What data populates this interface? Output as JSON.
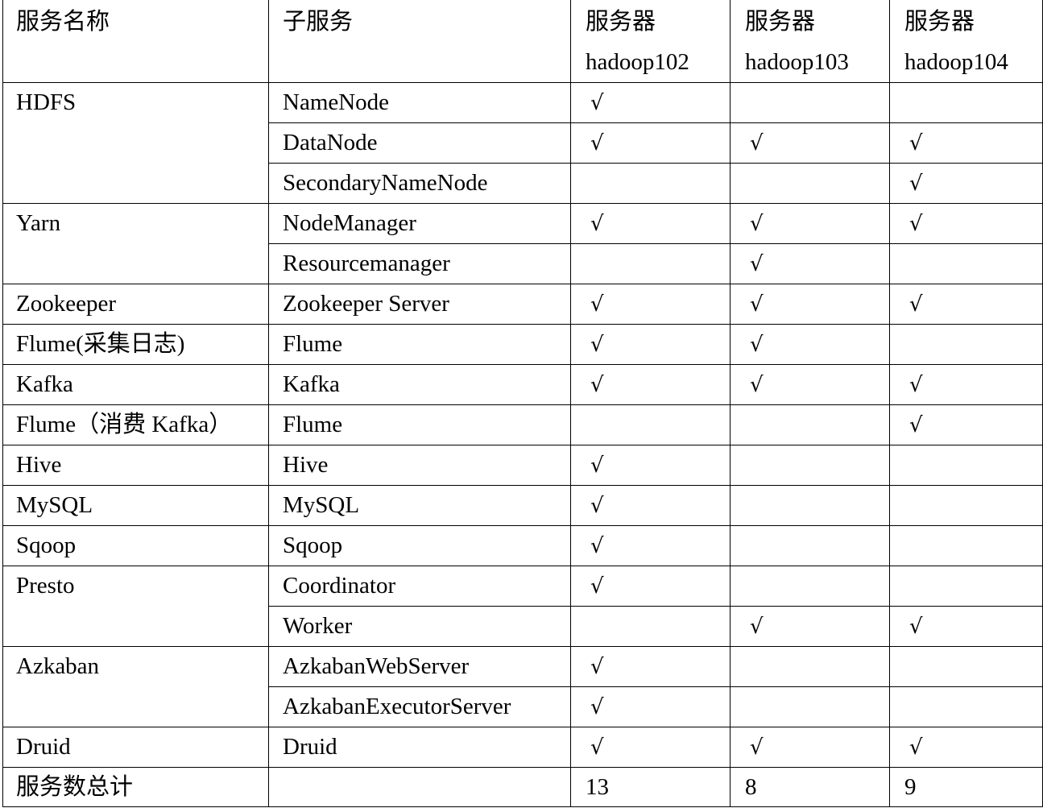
{
  "table": {
    "headers": {
      "service_name": "服务名称",
      "sub_service": "子服务",
      "servers": [
        {
          "label": "服务器",
          "host": "hadoop102"
        },
        {
          "label": "服务器",
          "host": "hadoop103"
        },
        {
          "label": "服务器",
          "host": "hadoop104"
        }
      ]
    },
    "check_mark": "√",
    "groups": [
      {
        "service": "HDFS",
        "rows": [
          {
            "sub": "NameNode",
            "marks": [
              true,
              false,
              false
            ]
          },
          {
            "sub": "DataNode",
            "marks": [
              true,
              true,
              true
            ]
          },
          {
            "sub": "SecondaryNameNode",
            "marks": [
              false,
              false,
              true
            ]
          }
        ]
      },
      {
        "service": "Yarn",
        "rows": [
          {
            "sub": "NodeManager",
            "marks": [
              true,
              true,
              true
            ]
          },
          {
            "sub": "Resourcemanager",
            "marks": [
              false,
              true,
              false
            ]
          }
        ]
      },
      {
        "service": "Zookeeper",
        "rows": [
          {
            "sub": "Zookeeper Server",
            "marks": [
              true,
              true,
              true
            ]
          }
        ]
      },
      {
        "service": "Flume(采集日志)",
        "rows": [
          {
            "sub": "Flume",
            "marks": [
              true,
              true,
              false
            ]
          }
        ]
      },
      {
        "service": "Kafka",
        "rows": [
          {
            "sub": "Kafka",
            "marks": [
              true,
              true,
              true
            ]
          }
        ]
      },
      {
        "service": "Flume（消费 Kafka）",
        "rows": [
          {
            "sub": "Flume",
            "marks": [
              false,
              false,
              true
            ]
          }
        ]
      },
      {
        "service": "Hive",
        "rows": [
          {
            "sub": "Hive",
            "marks": [
              true,
              false,
              false
            ]
          }
        ]
      },
      {
        "service": "MySQL",
        "rows": [
          {
            "sub": "MySQL",
            "marks": [
              true,
              false,
              false
            ]
          }
        ]
      },
      {
        "service": "Sqoop",
        "rows": [
          {
            "sub": "Sqoop",
            "marks": [
              true,
              false,
              false
            ]
          }
        ]
      },
      {
        "service": "Presto",
        "rows": [
          {
            "sub": "Coordinator",
            "marks": [
              true,
              false,
              false
            ]
          },
          {
            "sub": "Worker",
            "marks": [
              false,
              true,
              true
            ]
          }
        ]
      },
      {
        "service": "Azkaban",
        "rows": [
          {
            "sub": "AzkabanWebServer",
            "marks": [
              true,
              false,
              false
            ]
          },
          {
            "sub": "AzkabanExecutorServer",
            "marks": [
              true,
              false,
              false
            ]
          }
        ]
      },
      {
        "service": "Druid",
        "rows": [
          {
            "sub": "Druid",
            "marks": [
              true,
              true,
              true
            ]
          }
        ]
      }
    ],
    "total": {
      "label": "服务数总计",
      "sub": "",
      "values": [
        "13",
        "8",
        "9"
      ]
    }
  }
}
